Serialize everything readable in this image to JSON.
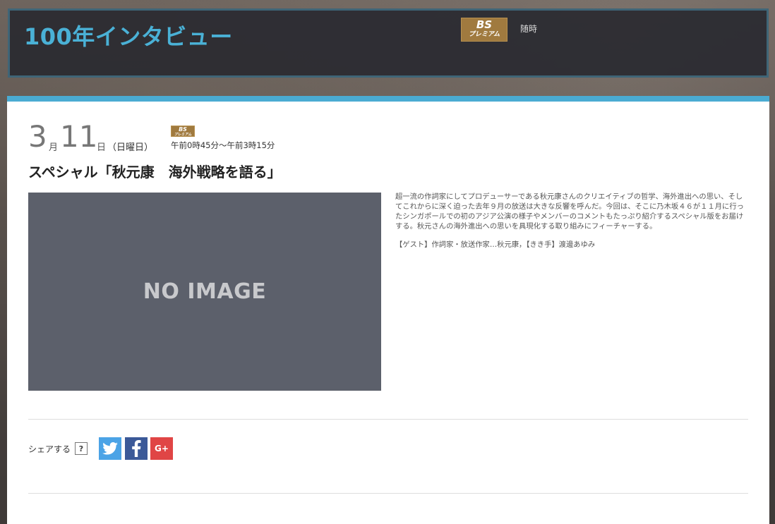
{
  "header": {
    "program_title": "100年インタビュー",
    "channel_logo": {
      "line1": "BS",
      "line2": "プレミアム"
    },
    "schedule": "随時"
  },
  "episode": {
    "month": "3",
    "month_unit": "月",
    "day": "11",
    "day_unit": "日",
    "weekday": "（日曜日）",
    "channel_logo": {
      "line1": "BS",
      "line2": "プレミアム"
    },
    "air_time": "午前0時45分～午前3時15分",
    "title": "スペシャル「秋元康　海外戦略を語る」",
    "image_placeholder": "NO IMAGE",
    "description": "超一流の作詞家にしてプロデューサーである秋元康さんのクリエイティブの哲学、海外進出への思い、そしてこれからに深く迫った去年９月の放送は大きな反響を呼んだ。今回は、そこに乃木坂４６が１１月に行ったシンガポールでの初のアジア公演の様子やメンバーのコメントもたっぷり紹介するスペシャル版をお届けする。秋元さんの海外進出への思いを具現化する取り組みにフィーチャーする。",
    "guest": "【ゲスト】作詞家・放送作家…秋元康，【きき手】渡邊あゆみ"
  },
  "share": {
    "label": "シェアする",
    "help": "?",
    "buttons": [
      {
        "name": "twitter",
        "icon": "twitter-icon",
        "color": "#4ba3e6"
      },
      {
        "name": "facebook",
        "icon": "facebook-icon",
        "color": "#3b5998"
      },
      {
        "name": "google-plus",
        "icon": "google-plus-icon",
        "label": "G+",
        "color": "#e04545"
      }
    ]
  },
  "colors": {
    "accent": "#4aabd2",
    "title": "#4ab1d6",
    "header_border": "#3f6577",
    "noimage_bg": "#5c606b"
  }
}
